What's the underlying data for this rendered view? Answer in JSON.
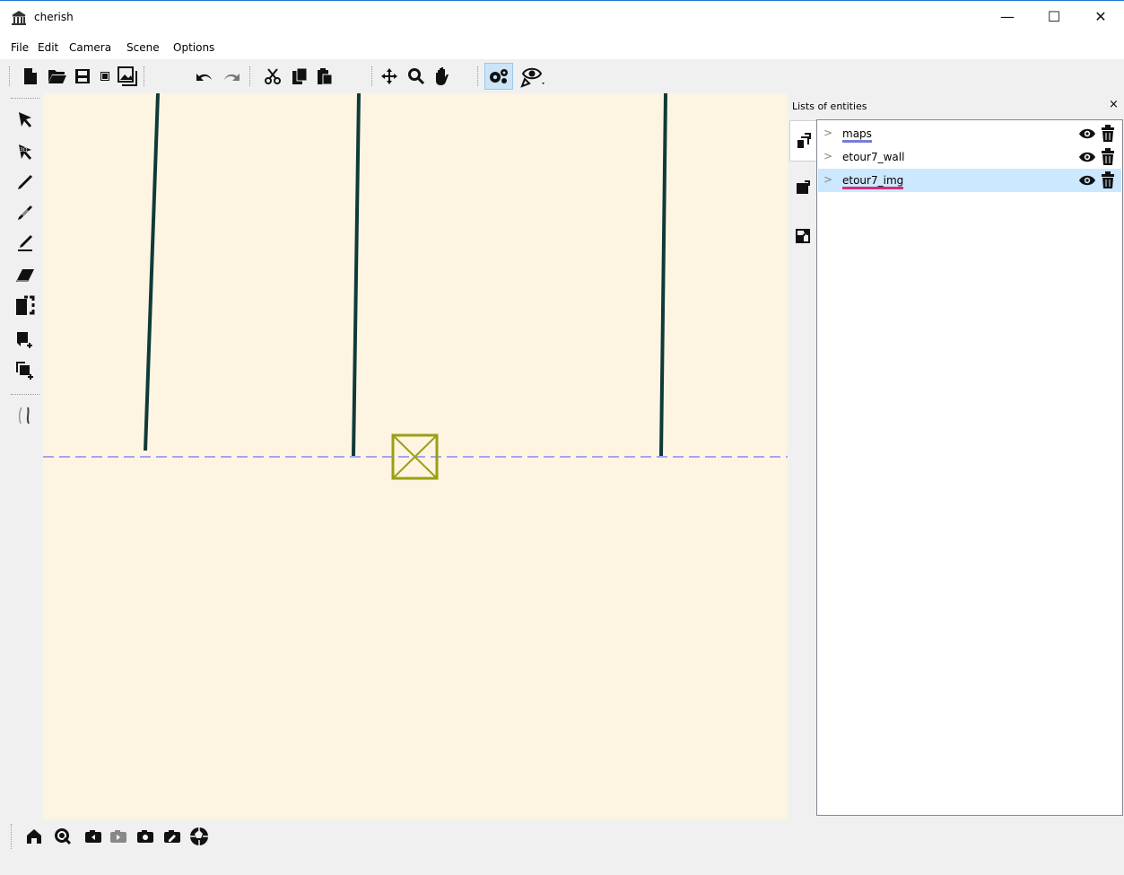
{
  "window": {
    "title": "cherish",
    "minimize": "—",
    "maximize": "☐",
    "close": "✕"
  },
  "menu": [
    "File",
    "Edit",
    "Camera",
    "Scene",
    "Options"
  ],
  "toolbar": {
    "icons": [
      "new-file-icon",
      "open-folder-icon",
      "save-icon",
      "small-image-icon",
      "screenshot-icon",
      "undo-icon",
      "redo-icon",
      "cut-icon",
      "copy-icon",
      "paste-icon",
      "move-icon",
      "zoom-icon",
      "pan-hand-icon",
      "settings-gears-icon",
      "visibility-eye-icon"
    ]
  },
  "left_tools": {
    "icons": [
      "select-arrow-icon",
      "select-3d-arrow-icon",
      "pen-icon",
      "pen-gray-icon",
      "pen-underline-icon",
      "eraser-icon",
      "select-region-icon",
      "add-canvas-icon",
      "add-canvas-copy-icon",
      "stroke-style-icon"
    ]
  },
  "dock": {
    "title": "Lists of entities",
    "close": "×",
    "entities": [
      {
        "name": "maps",
        "selected": false,
        "underline": "#7b7bd6"
      },
      {
        "name": "etour7_wall",
        "selected": false,
        "underline": null
      },
      {
        "name": "etour7_img",
        "selected": true,
        "underline": "#d0307a"
      }
    ]
  },
  "bottom_tools": {
    "icons": [
      "home-icon",
      "camera-search-icon",
      "camera-prev-icon",
      "camera-next-gray-icon",
      "camera-icon",
      "camera-edit-icon",
      "aperture-icon"
    ]
  },
  "colors": {
    "canvas": "#fdf5e2",
    "stroke": "#0f3a3a",
    "ground_line": "#8a8aee",
    "marker": "#99a014",
    "selection": "#cce8ff"
  }
}
